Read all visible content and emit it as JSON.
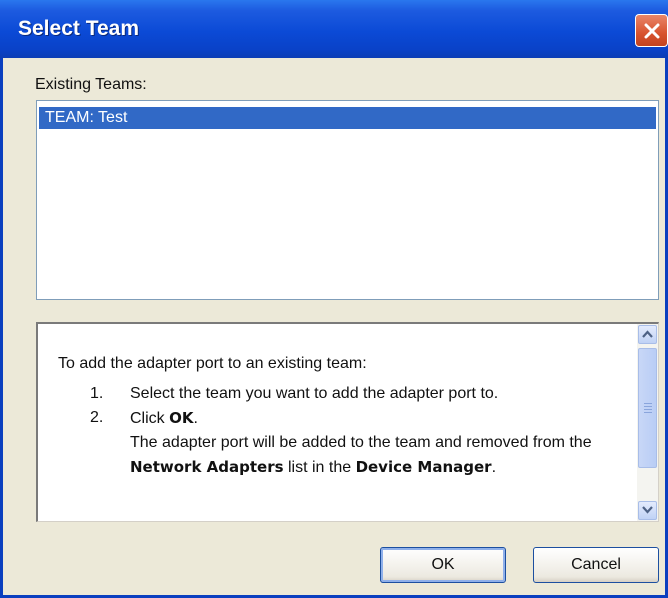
{
  "window": {
    "title": "Select Team"
  },
  "teams": {
    "label": "Existing Teams:",
    "items": [
      {
        "label": "TEAM: Test",
        "selected": true
      }
    ]
  },
  "info": {
    "intro": "To add the adapter port to an existing team:",
    "step1_num": "1.",
    "step1_text": "Select the team you want to add the adapter port to.",
    "step2_num": "2.",
    "step2_pre": "Click ",
    "step2_ok": "OK",
    "step2_post": ".",
    "note_pre": "The adapter port will be added to the team and removed from the ",
    "note_b1": "Network Adapters",
    "note_mid": " list in the ",
    "note_b2": "Device Manager",
    "note_end": "."
  },
  "buttons": {
    "ok": "OK",
    "cancel": "Cancel"
  },
  "colors": {
    "titlebar": "#0a42c8",
    "selection": "#3169c6",
    "dialog_bg": "#ece9d8",
    "close": "#d8532e"
  },
  "icons": {
    "close": "close-icon",
    "scroll_up": "chevron-up-icon",
    "scroll_down": "chevron-down-icon"
  }
}
